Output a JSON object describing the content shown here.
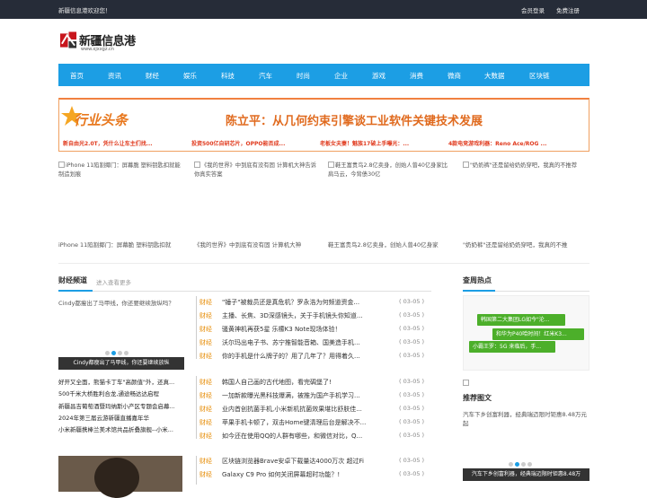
{
  "topbar": {
    "welcome": "新疆信息港欢迎您！",
    "login": "会员登录",
    "register": "免费注册"
  },
  "logo": {
    "name": "新疆信息港",
    "url": "www.xjxxgz.cn"
  },
  "nav": [
    "首页",
    "资讯",
    "财经",
    "娱乐",
    "科技",
    "汽车",
    "时尚",
    "企业",
    "游戏",
    "消费",
    "微商",
    "大数据",
    "区块链"
  ],
  "banner": {
    "badge": "行业头条",
    "headline": "陈立平：从几何约束引擎谈工业软件关键技术发展",
    "subs": [
      "新自由光2.0T，凭什么让车主们找...",
      "投资500亿自研芯片，OPPO能否成...",
      "老板女夫妻！魅族17破上手曝光：...",
      "4款电竞游戏利器：Reno Ace/ROG ..."
    ]
  },
  "photos": [
    {
      "alt": "iPhone 11陷割揶门：屏幕脆 塑料钥匙扣就能制造划痕",
      "caption": "iPhone 11陷割揶门：屏幕脆 塑料钥匙扣就"
    },
    {
      "alt": "《我的世界》中到底有没有固 计算机大神告诉你真实答案",
      "caption": "《我的世界》中到底有没有固 计算机大神"
    },
    {
      "alt": "鞋王富贵鸟2.8亿卖身，创始人曾40亿身家比肩马云，今背债30亿",
      "caption": "鞋王富贵鸟2.8亿卖身，创始人曾40亿身家"
    },
    {
      "alt": "\"奶奶裤\"还是留给奶奶穿吧，我真的不推荐",
      "caption": "\"奶奶裤\"还是留给奶奶穿吧，我真的不推"
    }
  ],
  "finance": {
    "title": "财经频道",
    "more": "进入查看更多"
  },
  "slide": {
    "alt": "Cindy都瘦出了马甲线，你还要继续放纵吗？",
    "caption": "Cindy都瘦出了马甲线，你还要继续放纵"
  },
  "left_list": [
    "好开又全面，熊猫卡丁车\"高颜值\"外，还真...",
    "500千米大桥胜利合龙,通途畅达达启程",
    "新疆昌吉葡萄酒暨玛纳斯小产区专题会启幕...",
    "2024年第三届云游新疆直播嘉年华",
    "小米新疆携棒兰美术馆共品折叠旗舰--小米..."
  ],
  "news_groups": [
    [
      {
        "cat": "财经",
        "title": "\"锤子\"被裁员还是真危机？罗永浩为何频道资金...",
        "date": "( 03-05 )"
      },
      {
        "cat": "财经",
        "title": "主播、长焦、3D深感镜头，关于手机镜头你知道...",
        "date": "( 03-05 )"
      },
      {
        "cat": "财经",
        "title": "骚黄神机再获5星 乐檬K3 Note现场体验！",
        "date": "( 03-05 )"
      },
      {
        "cat": "财经",
        "title": "沃尔玛出电子书、苏宁推智能音箱、国美造手机...",
        "date": "( 03-05 )"
      },
      {
        "cat": "财经",
        "title": "你的手机是什么牌子的？用了几年了？用得着久...",
        "date": "( 03-05 )"
      }
    ],
    [
      {
        "cat": "财经",
        "title": "韩国人自己画的古代地图，看完碉堡了!",
        "date": "( 03-05 )"
      },
      {
        "cat": "财经",
        "title": "一加新款曝光黑科技爆满，被推为国产手机学习...",
        "date": "( 03-05 )"
      },
      {
        "cat": "财经",
        "title": "业内首创抗菌手机,小米新机抗菌效果堪比舒肤佳...",
        "date": "( 03-05 )"
      },
      {
        "cat": "财经",
        "title": "苹果手机卡顿了，双击Home键清理后台是解决不...",
        "date": "( 03-05 )"
      },
      {
        "cat": "财经",
        "title": "如今还在使用QQ的人群有哪些，和微信对比，Q...",
        "date": "( 03-05 )"
      }
    ],
    [
      {
        "cat": "财经",
        "title": "区块链浏览器Brave安卓下载量达4000万次 超过Fi",
        "date": "( 03-05 )"
      },
      {
        "cat": "财经",
        "title": "Galaxy C9 Pro 如何关闭屏幕超时功能？!",
        "date": "( 03-05 )"
      }
    ]
  ],
  "hot": {
    "title": "查周热点",
    "tags": [
      "韩国第二大集团LG如今\"沦...",
      "和华为P40哈时间！红米K3...",
      "小霸王罗：5G 来临后，手..."
    ]
  },
  "recommend": {
    "title": "推荐图文",
    "alt": "汽车下乡创富利器，经典瑞迈限时钜惠8.48万元起",
    "caption": "汽车下乡创富利器，经典瑞迈限时钜惠8.48万"
  }
}
